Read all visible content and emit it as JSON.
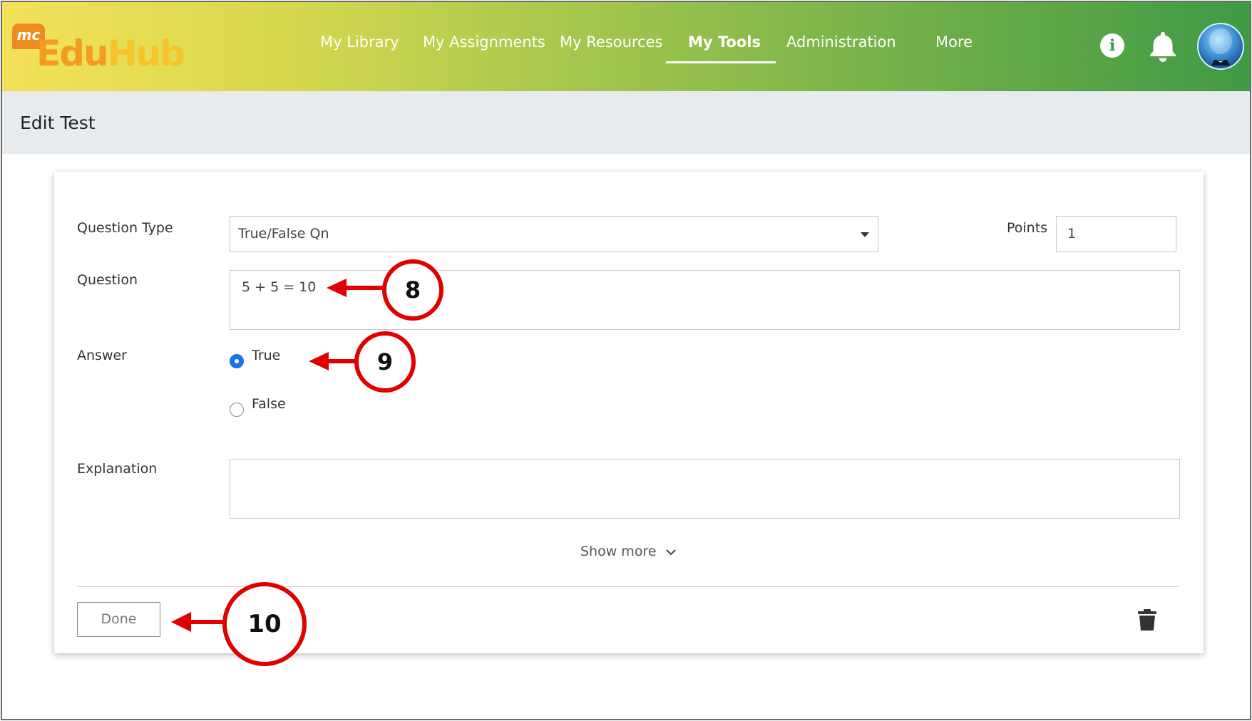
{
  "app": {
    "logo_badge": "mc",
    "logo_part1": "Edu",
    "logo_part2": "Hub"
  },
  "nav": {
    "items": [
      {
        "label": "My Library",
        "active": false
      },
      {
        "label": "My Assignments",
        "active": false
      },
      {
        "label": "My Resources",
        "active": false
      },
      {
        "label": "My Tools",
        "active": true
      },
      {
        "label": "Administration",
        "active": false
      },
      {
        "label": "More",
        "active": false
      }
    ],
    "info_glyph": "i",
    "icons": [
      "info-icon",
      "bell-icon",
      "user-avatar"
    ]
  },
  "page": {
    "title": "Edit Test"
  },
  "form": {
    "question_type_label": "Question Type",
    "question_type_value": "True/False Qn",
    "points_label": "Points",
    "points_value": "1",
    "question_label": "Question",
    "question_value": "5 + 5 = 10",
    "answer_label": "Answer",
    "answer_options": [
      {
        "label": "True",
        "selected": true
      },
      {
        "label": "False",
        "selected": false
      }
    ],
    "explanation_label": "Explanation",
    "explanation_value": "",
    "show_more_label": "Show more",
    "done_label": "Done",
    "icons": [
      "chevron-down-icon",
      "trash-icon"
    ]
  },
  "callouts": [
    "8",
    "9",
    "10"
  ],
  "colors": {
    "header_start": "#f4e15a",
    "header_end": "#3f9a44",
    "accent_blue": "#1a73e8",
    "callout_red": "#e00000"
  }
}
